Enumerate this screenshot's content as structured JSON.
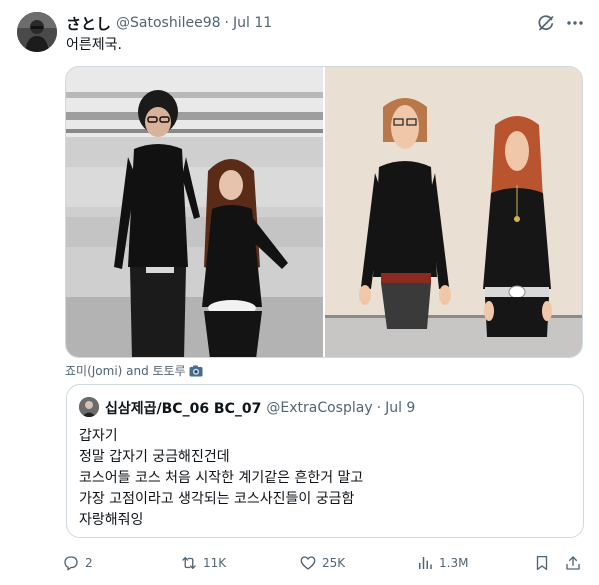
{
  "post": {
    "display_name": "さとし",
    "handle": "@Satoshilee98",
    "separator": "·",
    "date": "Jul 11",
    "text": "어른제국.",
    "media_caption": "죠미(Jomi) and 토토루"
  },
  "quote": {
    "display_name": "십삼제곱/BC_06 BC_07",
    "handle": "@ExtraCosplay",
    "separator": "·",
    "date": "Jul 9",
    "lines": [
      "갑자기",
      "정말 갑자기 궁금해진건데",
      "코스어들 코스 처음 시작한 계기같은 흔한거 말고",
      "가장 고점이라고 생각되는 코스사진들이 궁금함",
      "자랑해줘잉"
    ]
  },
  "actions": {
    "replies": "2",
    "reposts": "11K",
    "likes": "25K",
    "views": "1.3M"
  },
  "icons": [
    "grok-icon",
    "more-icon",
    "camera-icon",
    "reply-icon",
    "repost-icon",
    "like-icon",
    "views-icon",
    "bookmark-icon",
    "share-icon"
  ],
  "colors": {
    "text_primary": "#0f1419",
    "text_secondary": "#536471",
    "border": "#cfd9de"
  }
}
